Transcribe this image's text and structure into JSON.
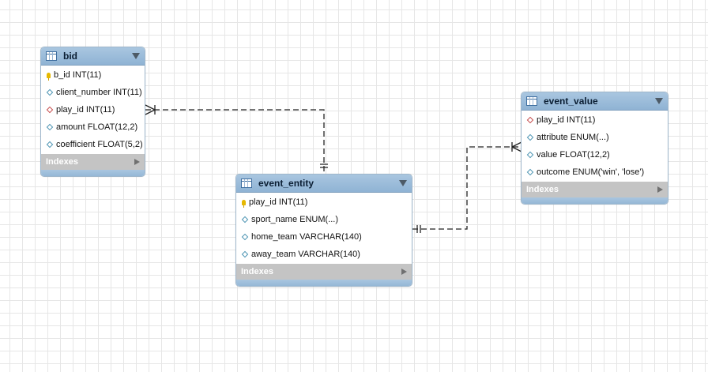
{
  "tables": [
    {
      "name": "bid",
      "columns": [
        {
          "text": "b_id INT(11)",
          "kind": "primary-key"
        },
        {
          "text": "client_number INT(11)",
          "kind": "column"
        },
        {
          "text": "play_id INT(11)",
          "kind": "foreign-key"
        },
        {
          "text": "amount FLOAT(12,2)",
          "kind": "column"
        },
        {
          "text": "coefficient FLOAT(5,2)",
          "kind": "column"
        }
      ],
      "indexes_label": "Indexes"
    },
    {
      "name": "event_entity",
      "columns": [
        {
          "text": "play_id INT(11)",
          "kind": "primary-key"
        },
        {
          "text": "sport_name ENUM(...)",
          "kind": "column"
        },
        {
          "text": "home_team VARCHAR(140)",
          "kind": "column"
        },
        {
          "text": "away_team VARCHAR(140)",
          "kind": "column"
        }
      ],
      "indexes_label": "Indexes"
    },
    {
      "name": "event_value",
      "columns": [
        {
          "text": "play_id INT(11)",
          "kind": "foreign-key"
        },
        {
          "text": "attribute ENUM(...)",
          "kind": "column"
        },
        {
          "text": "value FLOAT(12,2)",
          "kind": "column"
        },
        {
          "text": "outcome ENUM('win', 'lose')",
          "kind": "column"
        }
      ],
      "indexes_label": "Indexes"
    }
  ],
  "relationships": [
    {
      "from": "event_entity",
      "to": "bid",
      "cardinality": "one-to-many",
      "style": "dashed"
    },
    {
      "from": "event_entity",
      "to": "event_value",
      "cardinality": "one-to-many",
      "style": "dashed"
    }
  ],
  "colors": {
    "header": "#9fbfdc",
    "indexes_bar": "#c4c4c4",
    "primary_key": "#e6b800",
    "foreign_key_marker": "#c64a4a",
    "column_marker": "#4b93b3"
  }
}
